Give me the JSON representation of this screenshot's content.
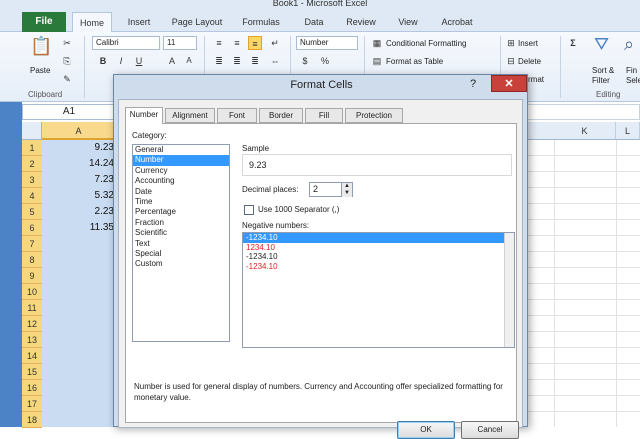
{
  "window": {
    "title": "Book1 - Microsoft Excel"
  },
  "ribbon_tabs": {
    "file": "File",
    "tabs": [
      "Home",
      "Insert",
      "Page Layout",
      "Formulas",
      "Data",
      "Review",
      "View",
      "Acrobat"
    ]
  },
  "ribbon": {
    "clipboard": {
      "paste": "Paste",
      "group": "Clipboard"
    },
    "font": {
      "name": "Calibri",
      "size": "11",
      "bold": "B",
      "italic": "I",
      "underline": "U"
    },
    "number": {
      "format": "Number",
      "currency": "$",
      "percent": "%"
    },
    "styles": {
      "conditional": "Conditional Formatting",
      "as_table": "Format as Table",
      "cell": "rmat"
    },
    "cells": {
      "insert": "Insert",
      "delete": "Delete"
    },
    "editing": {
      "sum": "Σ",
      "sort": "Sort &",
      "filter": "Filter",
      "find": "Fin",
      "select": "Sele",
      "group": "Editing"
    }
  },
  "formula_bar": {
    "namebox": "A1",
    "value": ""
  },
  "sheet": {
    "columns": [
      "A",
      "K",
      "L"
    ],
    "rows": [
      "1",
      "2",
      "3",
      "4",
      "5",
      "6",
      "7",
      "8",
      "9",
      "10",
      "11",
      "12",
      "13",
      "14",
      "15",
      "16",
      "17",
      "18"
    ],
    "col_a_values": [
      "9.23",
      "14.24",
      "7.23",
      "5.32",
      "2.23",
      "11.35"
    ]
  },
  "dialog": {
    "title": "Format Cells",
    "help": "?",
    "close": "✕",
    "tabs": [
      "Number",
      "Alignment",
      "Font",
      "Border",
      "Fill",
      "Protection"
    ],
    "category_label": "Category:",
    "categories": [
      "General",
      "Number",
      "Currency",
      "Accounting",
      "Date",
      "Time",
      "Percentage",
      "Fraction",
      "Scientific",
      "Text",
      "Special",
      "Custom"
    ],
    "selected_category": "Number",
    "sample_label": "Sample",
    "sample_value": "9.23",
    "decimal_label": "Decimal places:",
    "decimal_value": "2",
    "separator_label": "Use 1000 Separator (,)",
    "separator_checked": false,
    "negative_label": "Negative numbers:",
    "negative_numbers": [
      {
        "text": "-1234.10",
        "red": false,
        "selected": true
      },
      {
        "text": "1234.10",
        "red": true,
        "selected": false
      },
      {
        "text": "-1234.10",
        "red": false,
        "selected": false
      },
      {
        "text": "-1234.10",
        "red": true,
        "selected": false
      }
    ],
    "description": "Number is used for general display of numbers.  Currency and Accounting offer specialized formatting for monetary value.",
    "ok": "OK",
    "cancel": "Cancel"
  },
  "colors": {
    "file_tab": "#2a7a3b",
    "selection": "#3399ff",
    "close_button": "#c8413a",
    "negative_red": "#e02020"
  }
}
